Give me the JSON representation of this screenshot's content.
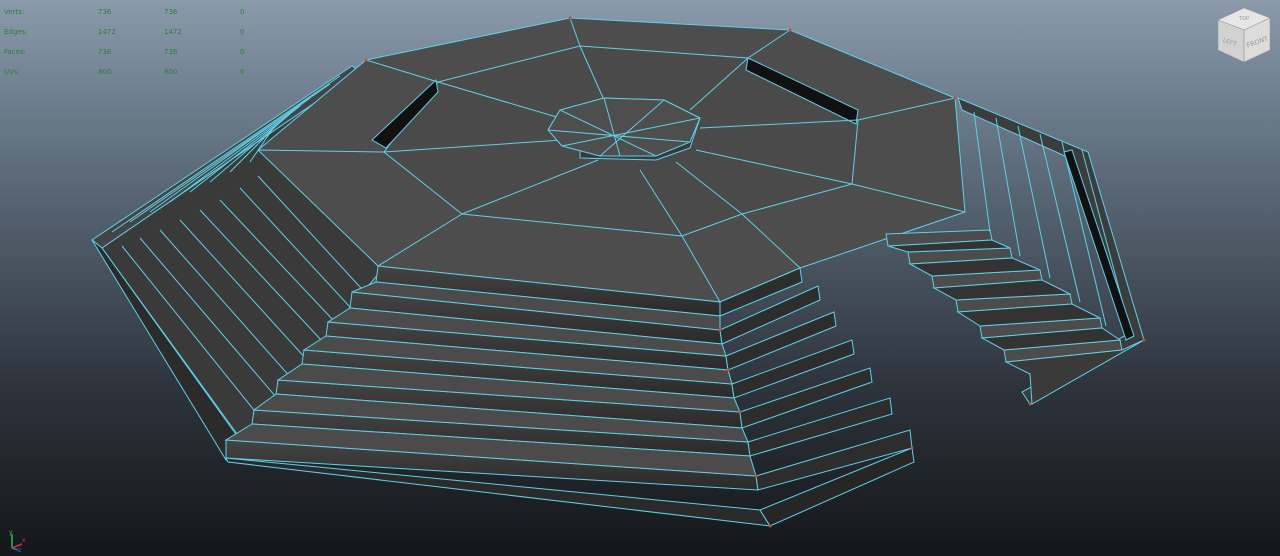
{
  "hud": {
    "rows": [
      {
        "label": "Verts:",
        "v1": "736",
        "v2": "736",
        "v3": "0"
      },
      {
        "label": "Edges:",
        "v1": "1472",
        "v2": "1472",
        "v3": "0"
      },
      {
        "label": "Faces:",
        "v1": "736",
        "v2": "736",
        "v3": "0"
      },
      {
        "label": "UVs:",
        "v1": "800",
        "v2": "800",
        "v3": "0"
      }
    ]
  },
  "viewcube": {
    "front_label": "FRONT",
    "left_label": "LEFT",
    "top_label": "TOP"
  },
  "axis": {
    "x_label": "x",
    "y_label": "y",
    "z_label": "z"
  },
  "colors": {
    "wire": "#5fd0e8",
    "face_top": "#4d4d4d",
    "face_side": "#3a3a3a",
    "vertex": "#c05030",
    "hud_text": "#2e7d3a"
  }
}
